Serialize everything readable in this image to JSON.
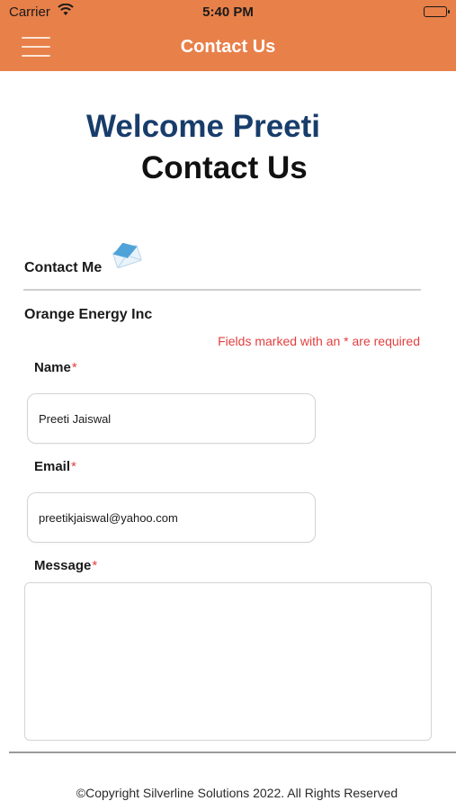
{
  "status_bar": {
    "carrier": "Carrier",
    "time": "5:40 PM"
  },
  "header": {
    "title": "Contact Us",
    "background_color": "#e8804a",
    "menu_icon": "hamburger-menu-icon"
  },
  "welcome": {
    "greeting": "Welcome Preeti",
    "page_title": "Contact Us",
    "greeting_color": "#183d6b"
  },
  "contact_section": {
    "heading": "Contact Me",
    "icon": "envelope-icon",
    "company": "Orange Energy Inc",
    "required_note": "Fields marked with an * are required",
    "required_color": "#e2403f"
  },
  "form": {
    "name_label": "Name",
    "name_value": "Preeti Jaiswal",
    "email_label": "Email",
    "email_value": "preetikjaiswal@yahoo.com",
    "message_label": "Message",
    "message_value": "",
    "required_marker": "*"
  },
  "footer": {
    "copyright": "©Copyright Silverline Solutions 2022. All Rights Reserved"
  }
}
